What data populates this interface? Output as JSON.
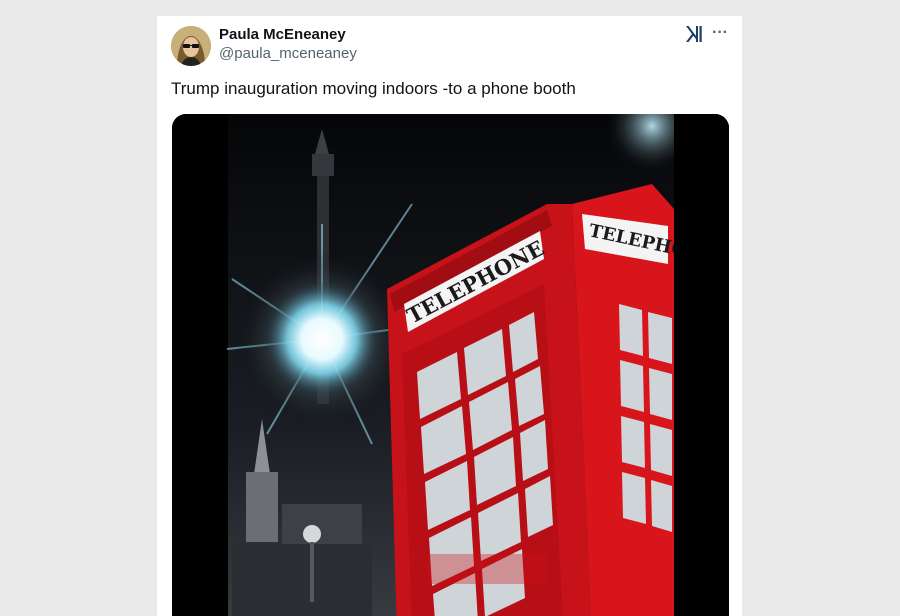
{
  "tweet": {
    "author_name": "Paula McEneaney",
    "author_handle": "@paula_mceneaney",
    "text": "Trump inauguration moving indoors -to a phone booth",
    "more_label": "···"
  },
  "icons": {
    "avatar": "avatar-photo",
    "brand": "x-logo-icon",
    "more": "more-options-icon"
  },
  "media": {
    "booth_sign_front": "TELEPHONE",
    "booth_sign_side": "TELEPHO"
  },
  "colors": {
    "booth_red": "#d8151b",
    "card_bg": "#ffffff",
    "page_bg": "#e9e9e9",
    "name_color": "#0f1419",
    "handle_color": "#536471"
  }
}
